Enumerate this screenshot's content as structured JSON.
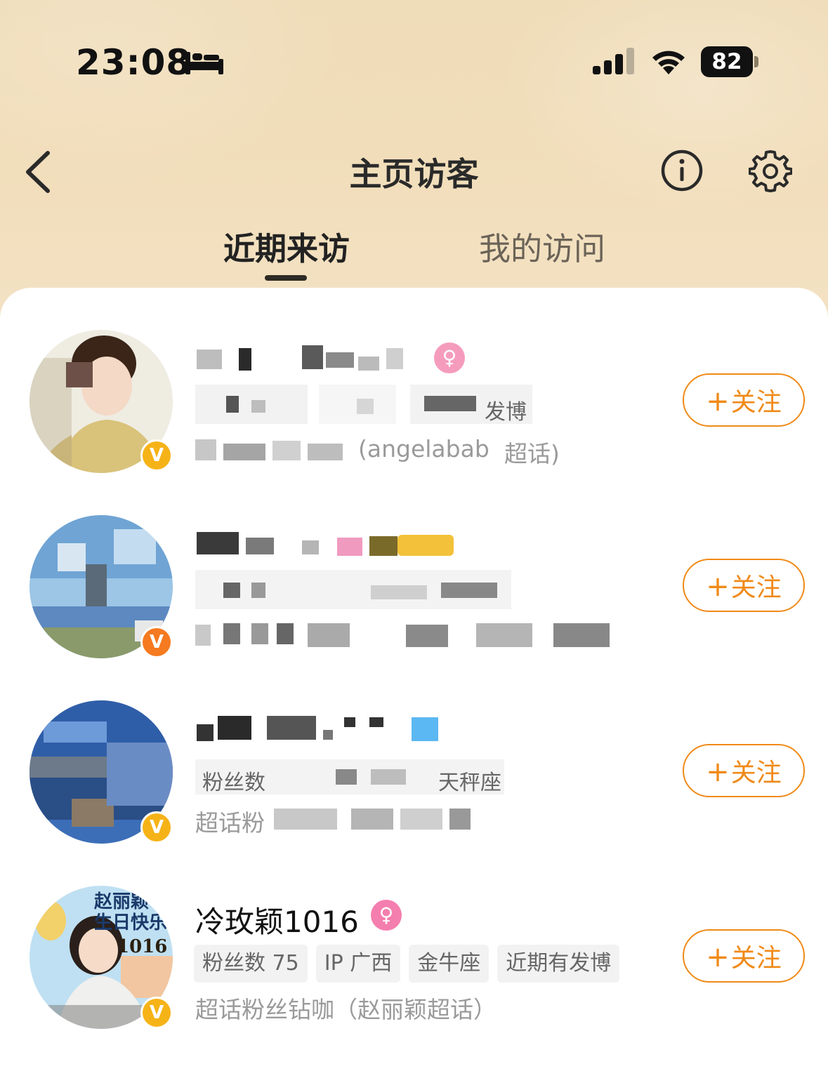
{
  "status_bar": {
    "time": "23:08",
    "battery": "82"
  },
  "nav": {
    "title": "主页访客"
  },
  "tabs": [
    {
      "label": "近期来访",
      "active": true
    },
    {
      "label": "我的访问",
      "active": false
    }
  ],
  "visitors": [
    {
      "name_visible": "",
      "tag_visible": "发博",
      "desc_visible": "(angelabab",
      "desc_tail": "超话)",
      "follow_label": "关注"
    },
    {
      "name_visible": "",
      "tag_visible": "",
      "desc_visible": "",
      "follow_label": "关注"
    },
    {
      "name_visible": "",
      "tag_prefix": "粉丝数",
      "tag_visible": "天秤座",
      "desc_visible": "超话粉",
      "follow_label": "关注"
    },
    {
      "name_visible": "冷玫颖1016",
      "avatar_text_top": "赵丽颖",
      "avatar_text_mid": "生日快乐",
      "avatar_text_num": "1016",
      "tags": [
        "粉丝数 75",
        "IP 广西",
        "金牛座",
        "近期有发博"
      ],
      "desc": "超话粉丝钻咖（赵丽颖超话）",
      "follow_label": "关注"
    }
  ],
  "colors": {
    "accent": "#f08a18",
    "verified": "#f6b318",
    "female": "#f47fae"
  }
}
